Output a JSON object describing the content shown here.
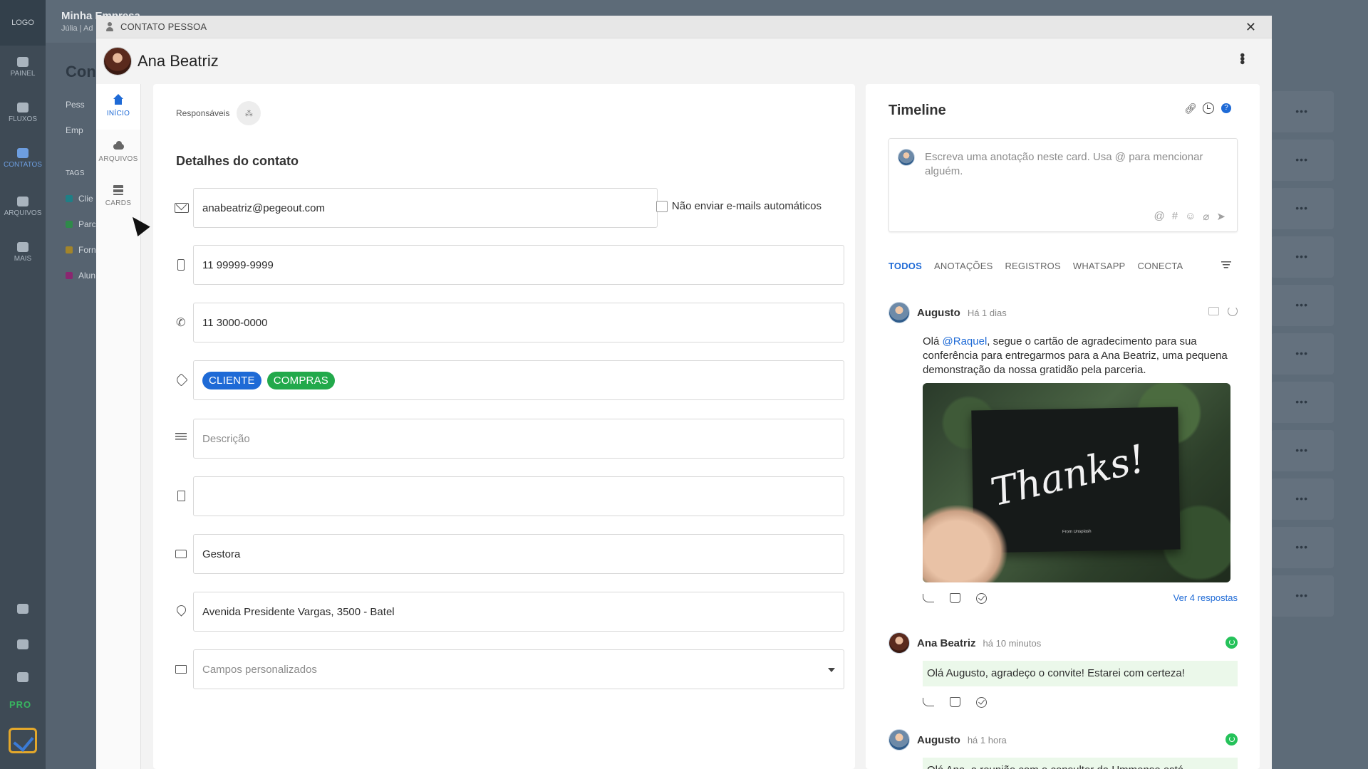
{
  "background": {
    "logo": "LOGO",
    "company": "Minha Empresa",
    "user": "Júlia | Ad",
    "title": "Con",
    "rail": [
      "PAINEL",
      "FLUXOS",
      "CONTATOS",
      "ARQUIVOS",
      "MAIS"
    ],
    "subitems": [
      "Pess",
      "Emp"
    ],
    "tags_label": "TAGS",
    "tags": [
      {
        "label": "Clie",
        "color": "#1f7f86"
      },
      {
        "label": "Parc",
        "color": "#2f8a4a"
      },
      {
        "label": "Forn",
        "color": "#a3852a"
      },
      {
        "label": "Alun",
        "color": "#8a2770"
      }
    ],
    "pro": "PRO"
  },
  "modal": {
    "header_title": "CONTATO PESSOA",
    "contact_name": "Ana Beatriz",
    "nav": [
      {
        "label": "INÍCIO"
      },
      {
        "label": "ARQUIVOS"
      },
      {
        "label": "CARDS"
      }
    ]
  },
  "details": {
    "responsaveis": "Responsáveis",
    "section_title": "Detalhes do contato",
    "email": "anabeatriz@pegeout.com",
    "no_email_label": "Não enviar e-mails automáticos",
    "mobile": "11 99999-9999",
    "phone": "11 3000-0000",
    "tags": [
      {
        "label": "CLIENTE",
        "color": "#1e6ad6"
      },
      {
        "label": "COMPRAS",
        "color": "#22a94b"
      }
    ],
    "description_placeholder": "Descrição",
    "company": "",
    "role": "Gestora",
    "address": "Avenida Presidente Vargas, 3500 -  Batel",
    "custom_fields_placeholder": "Campos personalizados"
  },
  "timeline": {
    "title": "Timeline",
    "composer_placeholder": "Escreva uma anotação neste card. Usa @ para mencionar alguém.",
    "tabs": [
      "TODOS",
      "ANOTAÇÕES",
      "REGISTROS",
      "WHATSAPP",
      "CONECTA"
    ],
    "posts": [
      {
        "author": "Augusto",
        "time": "Há 1 dias",
        "text_prefix": "Olá ",
        "mention": "@Raquel",
        "text_suffix": ", segue o  cartão de agradecimento para sua conferência para entregarmos para a Ana Beatriz, uma pequena demonstração da nossa  gratidão pela parceria.",
        "image_text": "Thanks!",
        "image_caption": "From Unsplash",
        "see_replies": "Ver 4 respostas"
      },
      {
        "author": "Ana Beatriz",
        "time": "há 10 minutos",
        "text": "Olá Augusto, agradeço o convite! Estarei com certeza!"
      },
      {
        "author": "Augusto",
        "time": "há 1 hora",
        "text": "Olá Ana,  a reunião com o consultor da Ummense está agendada. Se desejar, convide outros membros da sua"
      }
    ]
  }
}
